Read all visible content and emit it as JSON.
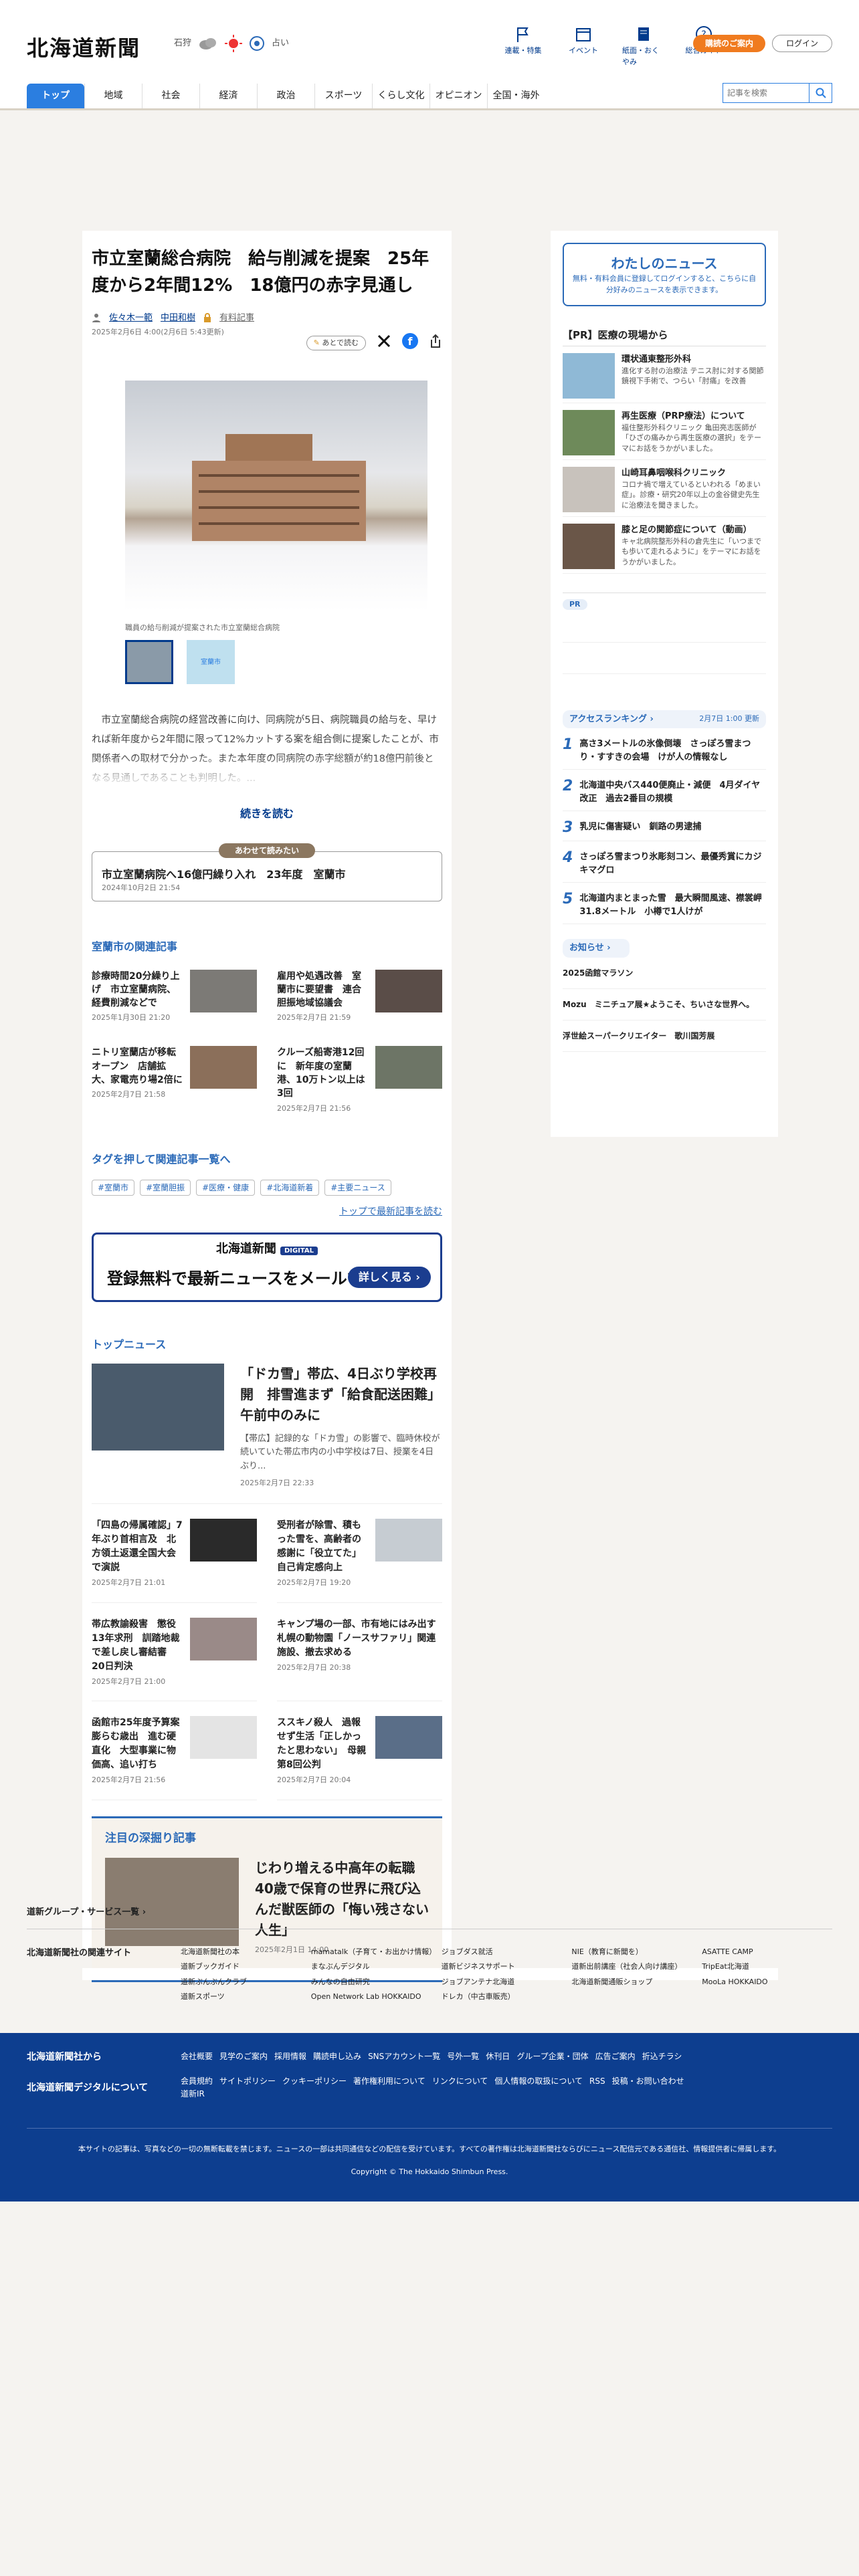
{
  "header": {
    "logo": "北海道新聞",
    "location": "石狩",
    "weather_note": "占い",
    "nav": [
      {
        "label": "連載・特集",
        "icon": "flag-icon"
      },
      {
        "label": "イベント",
        "icon": "calendar-icon"
      },
      {
        "label": "紙面・おくやみ",
        "icon": "newspaper-icon"
      },
      {
        "label": "総合ガイド",
        "icon": "question-icon"
      }
    ],
    "subscribe": "購読のご案内",
    "login": "ログイン",
    "tabs": [
      "トップ",
      "地域",
      "社会",
      "経済",
      "政治",
      "スポーツ",
      "くらし文化",
      "オピニオン",
      "全国・海外"
    ],
    "search_placeholder": "記事を検索"
  },
  "article": {
    "title": "市立室蘭総合病院　給与削減を提案　25年度から2年間12%　18億円の赤字見通し",
    "authors": [
      "佐々木一範",
      "中田和樹"
    ],
    "paid_label": "有料記事",
    "date": "2025年2月6日 4:00(2月6日 5:43更新)",
    "read_later": "あとで読む",
    "caption": "職員の給与削減が提案された市立室蘭総合病院",
    "thumb2_label": "室蘭市",
    "lead": "　市立室蘭総合病院の経営改善に向け、同病院が5日、病院職員の給与を、早ければ新年度から2年間に限って12%カットする案を組合側に提案したことが、市関係者への取材で分かった。また本年度の同病院の赤字総額が約18億円前後となる見通しであることも判明した。...",
    "readmore": "続きを読む",
    "together_label": "あわせて読みたい",
    "together_title": "市立室蘭病院へ16億円繰り入れ　23年度　室蘭市",
    "together_date": "2024年10月2日 21:54"
  },
  "related": {
    "heading": "室蘭市の関連記事",
    "items": [
      {
        "title": "診療時間20分繰り上げ　市立室蘭病院、経費削減などで",
        "date": "2025年1月30日 21:20"
      },
      {
        "title": "雇用や処遇改善　室蘭市に要望書　連合胆振地域協議会",
        "date": "2025年2月7日 21:59"
      },
      {
        "title": "ニトリ室蘭店が移転オープン　店舗拡大、家電売り場2倍に",
        "date": "2025年2月7日 21:58"
      },
      {
        "title": "クルーズ船寄港12回に　新年度の室蘭港、10万トン以上は3回",
        "date": "2025年2月7日 21:56"
      }
    ]
  },
  "tags": {
    "heading": "タグを押して関連記事一覧へ",
    "items": [
      "#室蘭市",
      "#室蘭胆振",
      "#医療・健康",
      "#北海道新着",
      "#主要ニュース"
    ],
    "toplink": "トップで最新記事を読む"
  },
  "banner": {
    "logo": "北海道新聞",
    "digital": "DIGITAL",
    "message": "登録無料で最新ニュースをメールでお届け",
    "button": "詳しく見る ›"
  },
  "topnews": {
    "heading": "トップニュース",
    "main": {
      "title": "「ドカ雪」帯広、4日ぶり学校再開　排雪進まず「給食配送困難」　午前中のみに",
      "summary": "【帯広】記録的な「ドカ雪」の影響で、臨時休校が続いていた帯広市内の小中学校は7日、授業を4日ぶり...",
      "date": "2025年2月7日 22:33"
    },
    "items": [
      {
        "title": "「四島の帰属確認」7年ぶり首相言及　北方領土返還全国大会で演説",
        "date": "2025年2月7日 21:01"
      },
      {
        "title": "受刑者が除雪、積もった雪を、高齢者の感謝に「役立てた」　自己肯定感向上",
        "date": "2025年2月7日 19:20"
      },
      {
        "title": "帯広教諭殺害　懲役13年求刑　訓踏地裁で差し戻し審結審　20日判決",
        "date": "2025年2月7日 21:00"
      },
      {
        "title": "キャンプ場の一部、市有地にはみ出す　札幌の動物園「ノースサファリ」関連施設、撤去求める",
        "date": "2025年2月7日 20:38"
      },
      {
        "title": "函館市25年度予算案　膨らむ歳出　進む硬直化　大型事業に物価高、追い打ち",
        "date": "2025年2月7日 21:56"
      },
      {
        "title": "ススキノ殺人　過報せず生活「正しかったと思わない」　母親第8回公判",
        "date": "2025年2月7日 20:04"
      }
    ]
  },
  "deep": {
    "heading": "注目の深掘り記事",
    "title": "じわり増える中高年の転職　40歳で保育の世界に飛び込んだ獣医師の「悔い残さない人生」",
    "date": "2025年2月1日 14:00"
  },
  "sidebar": {
    "mynews_title": "わたしのニュース",
    "mynews_text": "無料・有料会員に登録してログインすると、こちらに自分好みのニュースを表示できます。",
    "pr_heading": "【PR】医療の現場から",
    "pr": [
      {
        "title": "環状通東整形外科",
        "desc": "進化する肘の治療法 テニス肘に対する関節鏡視下手術で、つらい「肘痛」を改善"
      },
      {
        "title": "再生医療（PRP療法）について",
        "desc": "福住整形外科クリニック 亀田亮志医師が「ひざの痛みから再生医療の選択」をテーマにお話をうかがいました。"
      },
      {
        "title": "山崎耳鼻咽喉科クリニック",
        "desc": "コロナ禍で増えているといわれる「めまい症」。診療・研究20年以上の金谷健史先生に治療法を聞きました。"
      },
      {
        "title": "膝と足の関節症について（動画）",
        "desc": "キャ北病院整形外科の倉先生に「いつまでも歩いて走れるように」をテーマにお話をうかがいました。"
      }
    ],
    "pr_label": "PR",
    "rank_heading": "アクセスランキング",
    "rank_time": "2月7日 1:00 更新",
    "rank": [
      {
        "n": "1",
        "t": "高さ3メートルの氷像倒壊　さっぽろ雪まつり・すすきの会場　けが人の情報なし"
      },
      {
        "n": "2",
        "t": "北海道中央バス440便廃止・減便　4月ダイヤ改正　過去2番目の規模"
      },
      {
        "n": "3",
        "t": "乳児に傷害疑い　釧路の男逮捕"
      },
      {
        "n": "4",
        "t": "さっぽろ雪まつり氷彫刻コン、最優秀賞にカジキマグロ"
      },
      {
        "n": "5",
        "t": "北海道内まとまった雪　最大瞬間風速、襟裳岬31.8メートル　小樽で1人けが"
      }
    ],
    "notice_heading": "お知らせ",
    "notices": [
      "2025函館マラソン",
      "Mozu　ミニチュア展★ようこそ、ちいさな世界へ。",
      "浮世絵スーパークリエイター　歌川国芳展"
    ]
  },
  "services": {
    "heading": "道新グループ・サービス一覧",
    "related_title": "北海道新聞社の関連サイト",
    "sites": [
      "北海道新聞社の本",
      "mamatalk（子育て・お出かけ情報）",
      "ジョブダス就活",
      "NIE（教育に新聞を）",
      "ASATTE CAMP",
      "道新ブックガイド",
      "まなぶんデジタル",
      "道新ビジネスサポート",
      "道新出前講座（社会人向け講座）",
      "TripEat北海道",
      "道新ぶんぶんクラブ",
      "みんなの自由研究",
      "ジョブアンテナ北海道",
      "北海道新聞通販ショップ",
      "MooLa HOKKAIDO",
      "道新スポーツ",
      "Open Network Lab HOKKAIDO",
      "ドレカ（中古車販売）",
      "",
      ""
    ]
  },
  "footer": {
    "l1": "北海道新聞社から",
    "l2": "北海道新聞デジタルについて",
    "links1": [
      "会社概要",
      "見学のご案内",
      "採用情報",
      "購読申し込み",
      "SNSアカウント一覧",
      "号外一覧",
      "休刊日",
      "グループ企業・団体",
      "広告ご案内",
      "折込チラシ"
    ],
    "links2": [
      "会員規約",
      "サイトポリシー",
      "クッキーポリシー",
      "著作権利用について",
      "リンクについて",
      "個人情報の取扱について",
      "RSS",
      "投稿・お問い合わせ",
      "道新IR"
    ],
    "note": "本サイトの記事は、写真などの一切の無断転載を禁じます。ニュースの一部は共同通信などの配信を受けています。すべての著作権は北海道新聞社ならびにニュース配信元である通信社、情報提供者に帰属します。",
    "copyright": "Copyright © The Hokkaido Shimbun Press."
  }
}
